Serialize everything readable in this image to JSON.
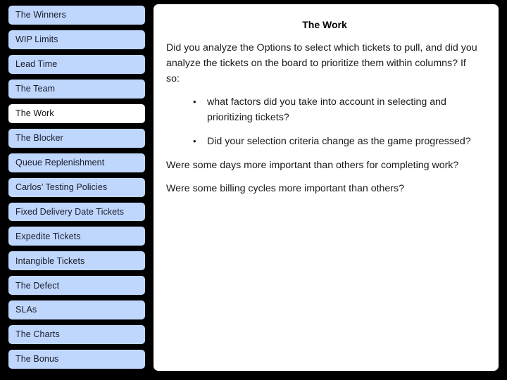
{
  "slide": {
    "background_color": "#000000",
    "accent_color": "#bfd7fc",
    "selected_color": "#ffffff"
  },
  "sidebar": {
    "items": [
      {
        "label": "The Winners",
        "selected": false
      },
      {
        "label": "WIP Limits",
        "selected": false
      },
      {
        "label": "Lead Time",
        "selected": false
      },
      {
        "label": "The Team",
        "selected": false
      },
      {
        "label": "The Work",
        "selected": true
      },
      {
        "label": "The Blocker",
        "selected": false
      },
      {
        "label": "Queue Replenishment",
        "selected": false
      },
      {
        "label": "Carlos’ Testing Policies",
        "selected": false
      },
      {
        "label": "Fixed Delivery Date Tickets",
        "selected": false
      },
      {
        "label": "Expedite Tickets",
        "selected": false
      },
      {
        "label": "Intangible Tickets",
        "selected": false
      },
      {
        "label": "The Defect",
        "selected": false
      },
      {
        "label": "SLAs",
        "selected": false
      },
      {
        "label": "The Charts",
        "selected": false
      },
      {
        "label": "The Bonus",
        "selected": false
      }
    ]
  },
  "content": {
    "title": "The Work",
    "intro_paragraph": "Did you analyze the Options to select which tickets to pull, and did you analyze the tickets on the board to prioritize them within columns? If so:",
    "bullets": [
      "what factors did you take into account in selecting and prioritizing tickets?",
      "Did your selection criteria change as the game progressed?"
    ],
    "closing_paragraphs": [
      "Were some days more important than others for completing work?",
      "Were some billing cycles more important than others?"
    ]
  }
}
